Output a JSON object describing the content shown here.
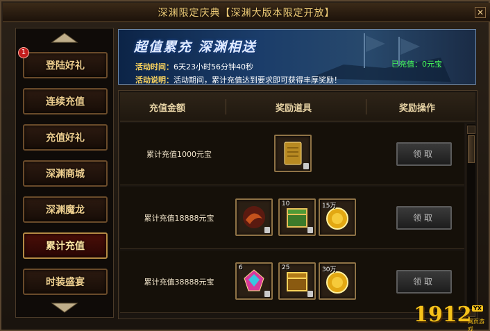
{
  "window": {
    "title": "深渊限定庆典【深渊大版本限定开放】",
    "close_glyph": "✕"
  },
  "sidebar": {
    "badge": "1",
    "items": [
      {
        "label": "登陆好礼"
      },
      {
        "label": "连续充值"
      },
      {
        "label": "充值好礼"
      },
      {
        "label": "深渊商城"
      },
      {
        "label": "深渊魔龙"
      },
      {
        "label": "累计充值"
      },
      {
        "label": "时装盛宴"
      }
    ],
    "active_index": 5
  },
  "banner": {
    "title": "超值累充 深渊相送",
    "time_label": "活动时间：",
    "time_value": "6天23小时56分钟40秒",
    "desc_label": "活动说明：",
    "desc_value": "活动期间，累计充值达到要求即可获得丰厚奖励！",
    "recharged": "已充值：0元宝"
  },
  "table": {
    "headers": [
      "充值金额",
      "奖励道具",
      "奖励操作"
    ],
    "rows": [
      {
        "label": "累计充值1000元宝",
        "button": "领取",
        "items": [
          {
            "icon": "gold-scroll-icon",
            "count": ""
          }
        ]
      },
      {
        "label": "累计充值18888元宝",
        "button": "领取",
        "items": [
          {
            "icon": "dragon-mount-icon",
            "count": ""
          },
          {
            "icon": "treasure-chest-icon",
            "count": "10"
          },
          {
            "icon": "gold-coin-icon",
            "count": "15万"
          }
        ]
      },
      {
        "label": "累计充值38888元宝",
        "button": "领取",
        "items": [
          {
            "icon": "rainbow-gem-icon",
            "count": "6"
          },
          {
            "icon": "gold-chest-icon",
            "count": "25"
          },
          {
            "icon": "gold-coin-icon",
            "count": "30万"
          }
        ]
      }
    ]
  },
  "logo": {
    "number": "1912",
    "tag": "YX",
    "sub": "网页游戏"
  },
  "colors": {
    "gold_text": "#f0d090",
    "banner_bg": "#1b3d6a",
    "recharged_green": "#46ff5a",
    "active_red": "#4a0e08"
  }
}
